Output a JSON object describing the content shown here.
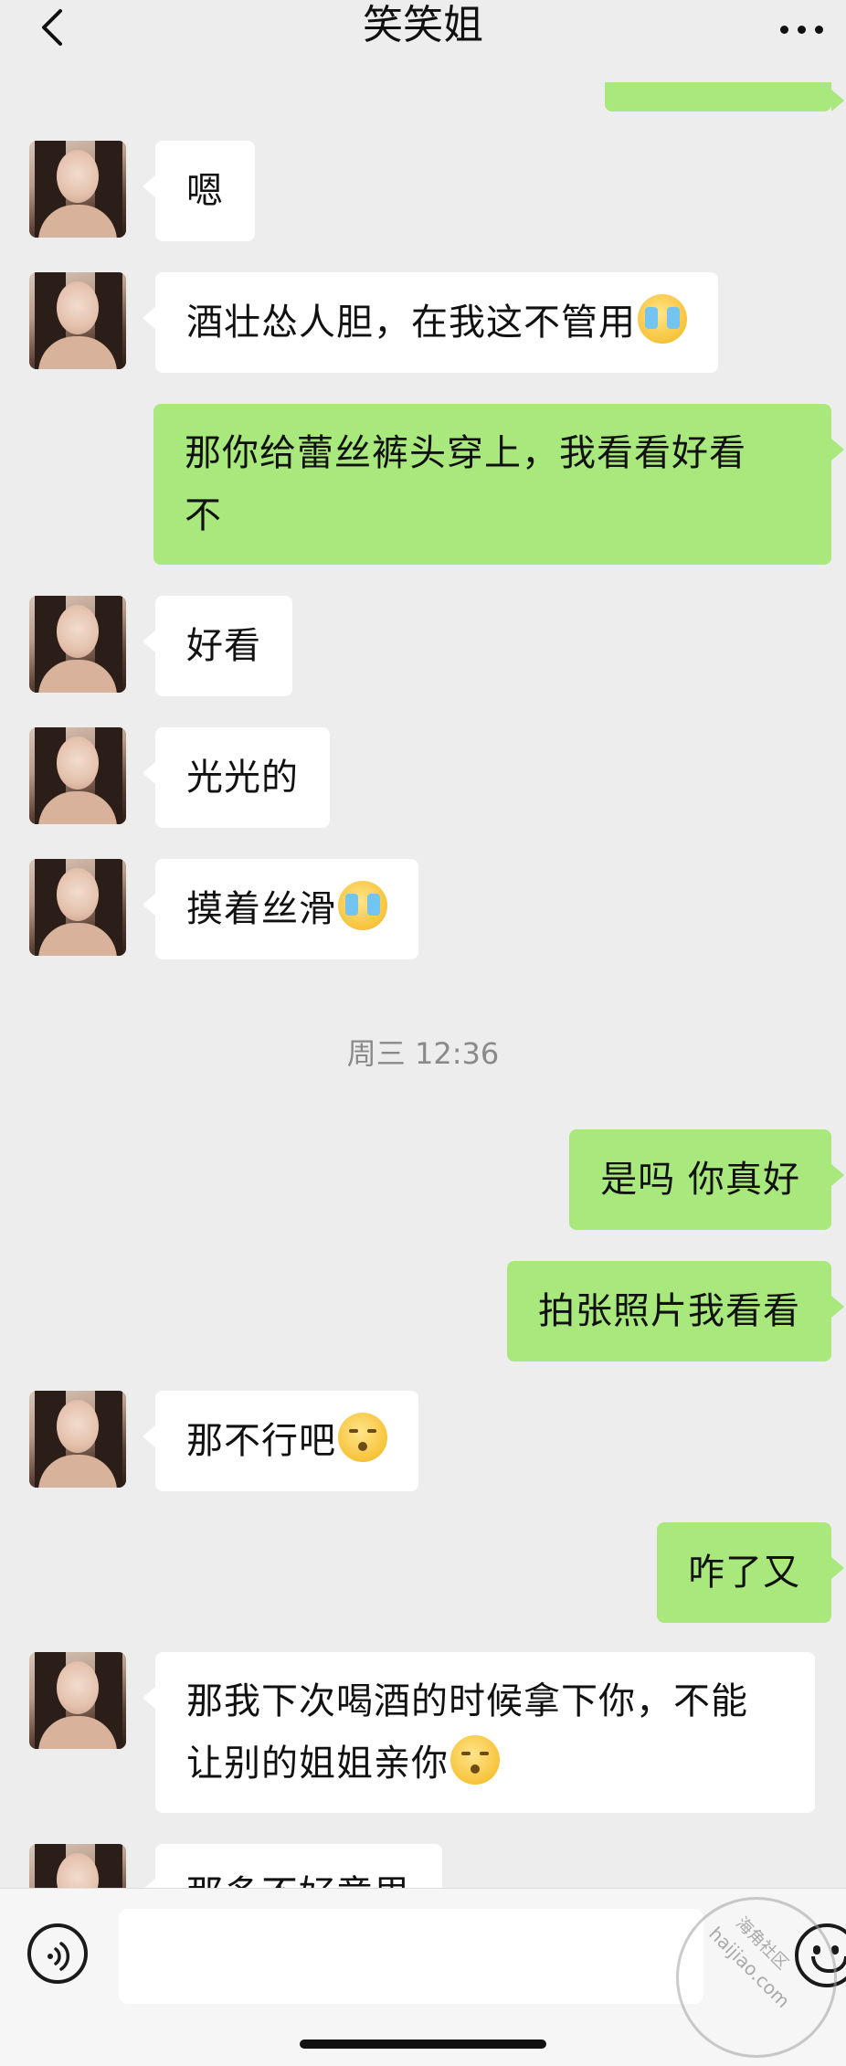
{
  "header": {
    "title": "笑笑姐"
  },
  "messages": [
    {
      "side": "in",
      "text": "嗯"
    },
    {
      "side": "in",
      "text": "酒壮怂人胆，在我这不管用",
      "emoji": "crying-face"
    },
    {
      "side": "out",
      "line1": "那你给蕾丝裤头穿上，我看看好看",
      "line2": "不"
    },
    {
      "side": "in",
      "text": "好看"
    },
    {
      "side": "in",
      "text": "光光的"
    },
    {
      "side": "in",
      "text": "摸着丝滑",
      "emoji": "crying-face"
    },
    {
      "side": "out",
      "text": "是吗 你真好"
    },
    {
      "side": "out",
      "text": "拍张照片我看看"
    },
    {
      "side": "in",
      "text": "那不行吧",
      "emoji": "kissing-face"
    },
    {
      "side": "out",
      "text": "咋了又"
    },
    {
      "side": "in",
      "line1": "那我下次喝酒的时候拿下你，不能",
      "line2": "让别的姐姐亲你",
      "emoji": "kissing-face"
    },
    {
      "side": "in",
      "text": "那多不好意思"
    }
  ],
  "timestamp": "周三 12:36",
  "watermark": {
    "text": "haijiao.com",
    "text_cn": "海角社区"
  },
  "icons": {
    "back": "chevron-left-icon",
    "more": "ellipsis-icon",
    "voice": "voice-icon",
    "emoji": "emoji-icon"
  },
  "colors": {
    "background": "#ededed",
    "incoming_bubble": "#ffffff",
    "outgoing_bubble": "#a9e87c"
  }
}
